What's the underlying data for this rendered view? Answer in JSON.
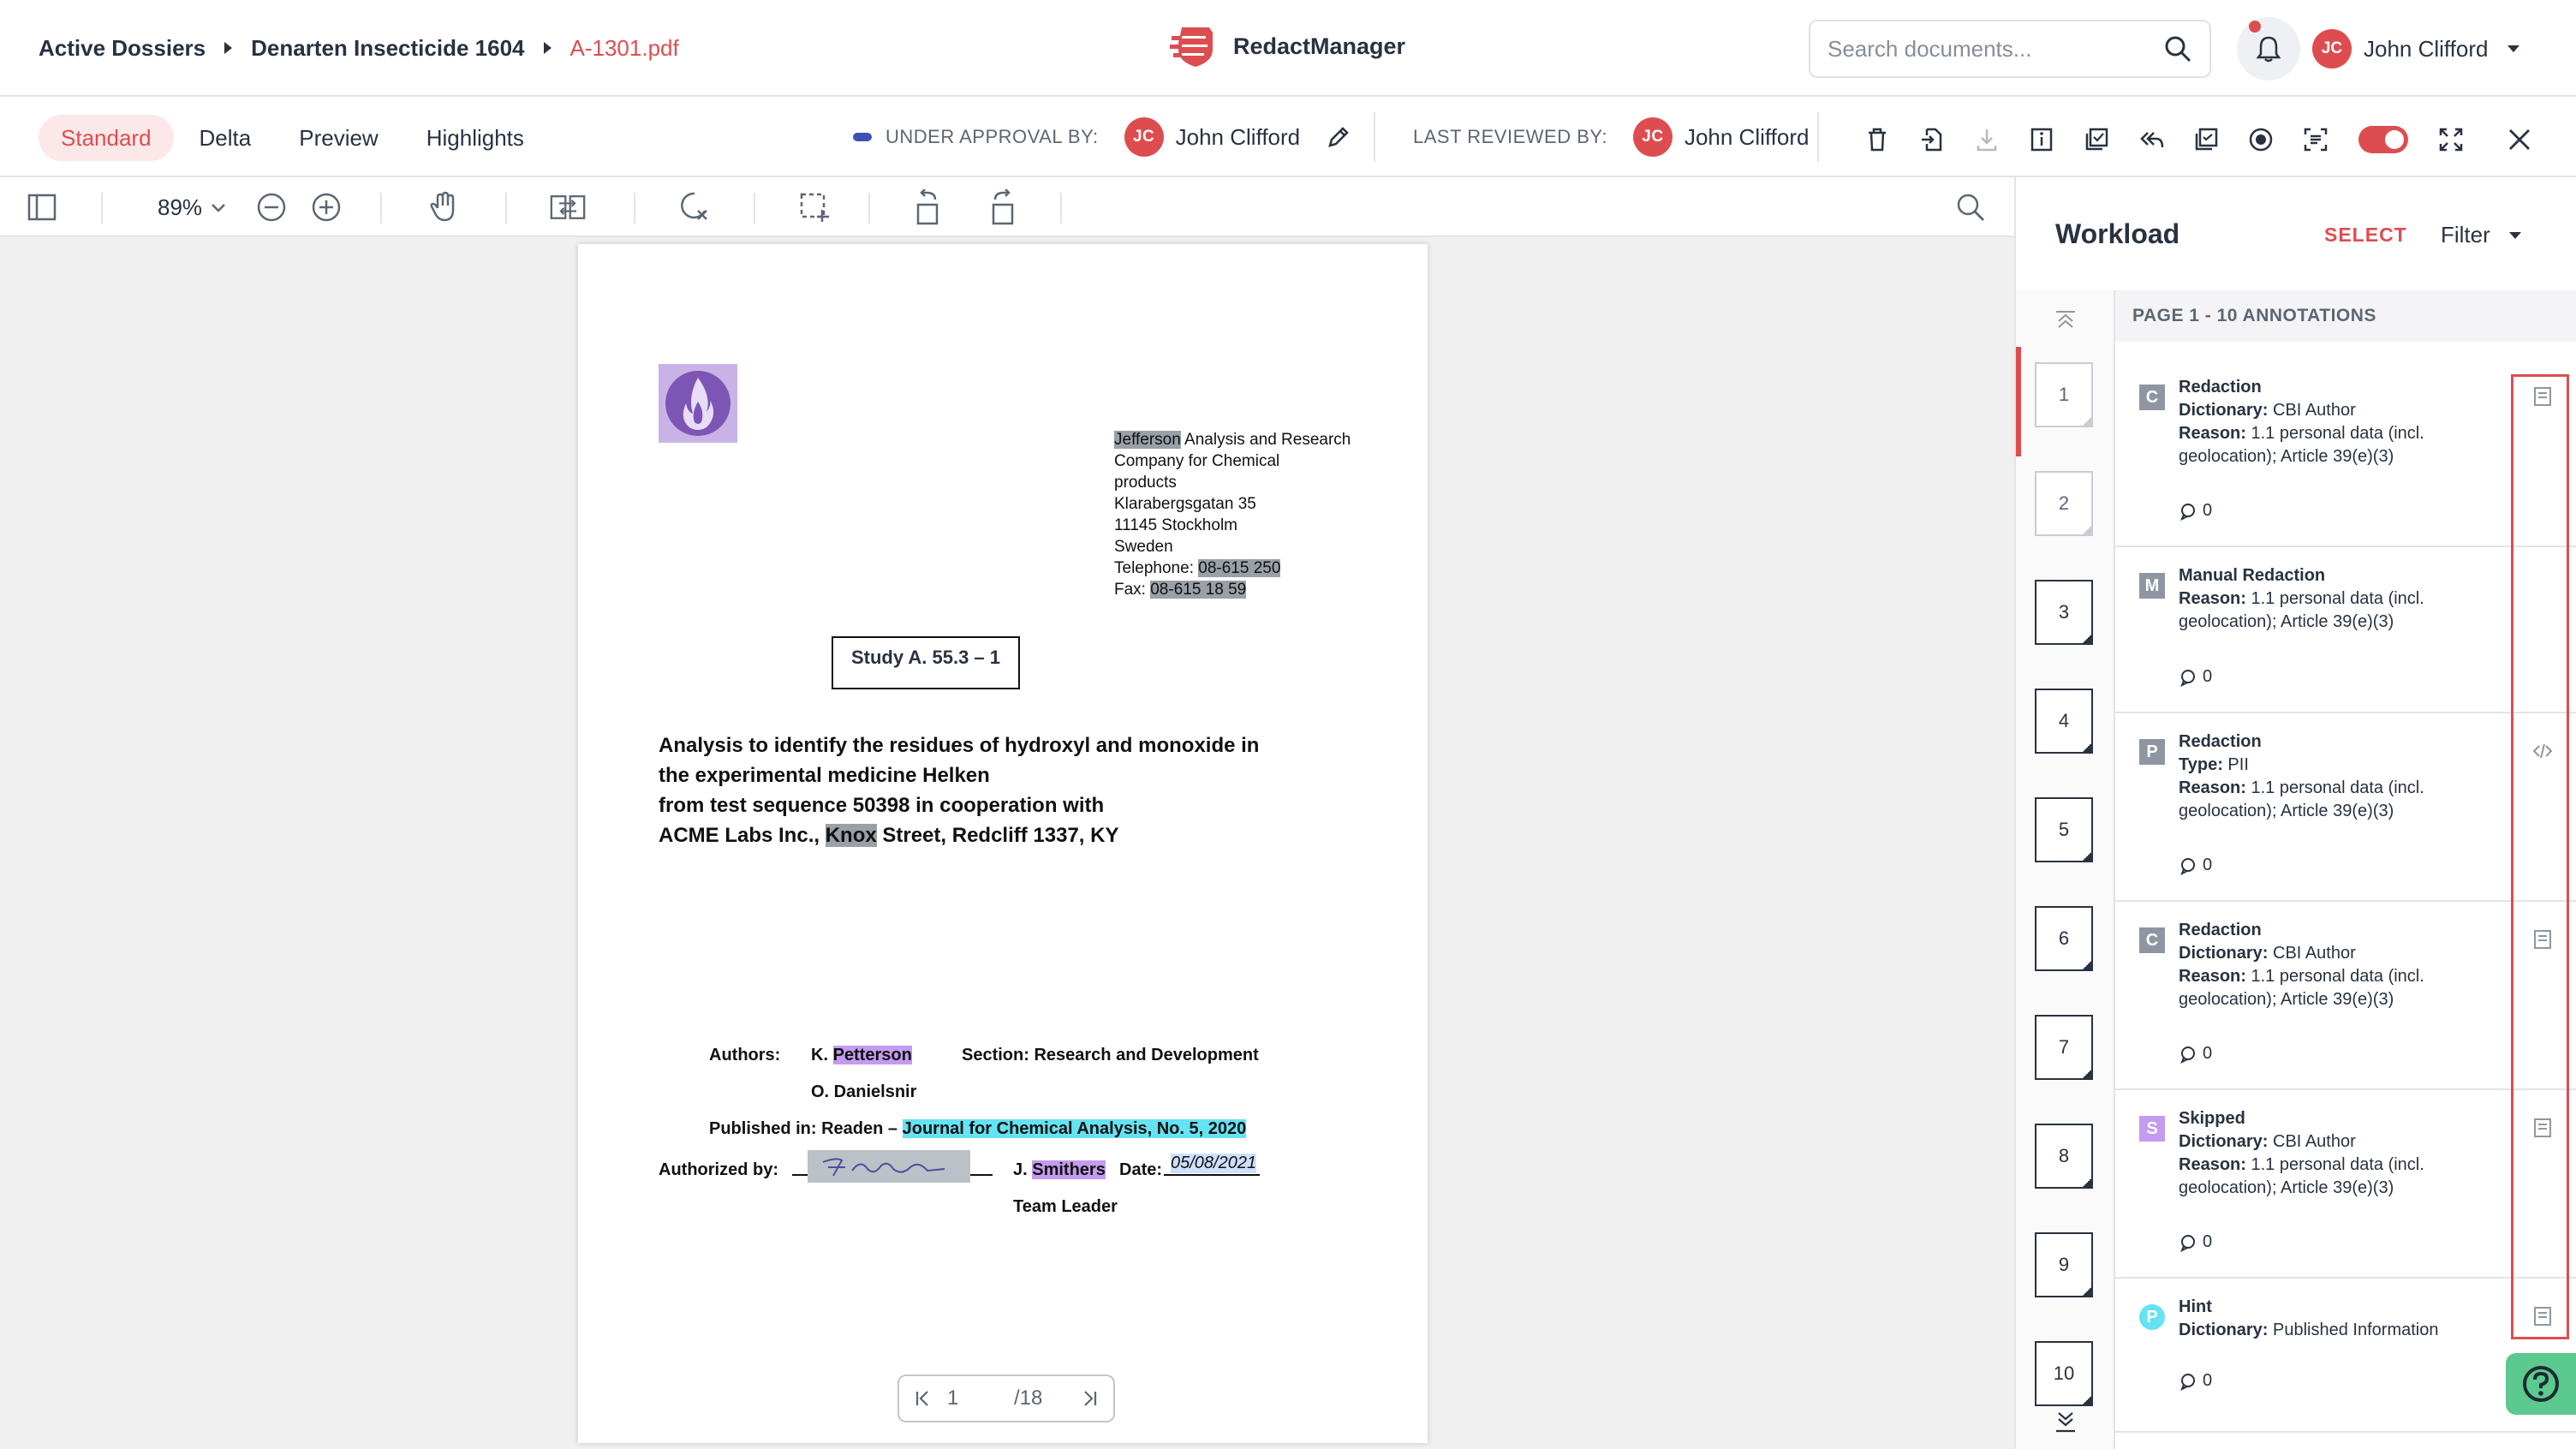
{
  "breadcrumbs": [
    "Active Dossiers",
    "Denarten Insecticide 1604",
    "A-1301.pdf"
  ],
  "brand": {
    "name": "RedactManager",
    "accent": "#dd4d50"
  },
  "search": {
    "placeholder": "Search documents..."
  },
  "user": {
    "initials": "JC",
    "name": "John Clifford"
  },
  "tabs": [
    "Standard",
    "Delta",
    "Preview",
    "Highlights"
  ],
  "status": {
    "approval_label": "UNDER APPROVAL BY:",
    "approval_user": "John Clifford",
    "reviewed_label": "LAST REVIEWED BY:",
    "reviewed_user": "John Clifford"
  },
  "viewer": {
    "zoom": "89",
    "zoom_unit": "%",
    "page": "1",
    "total": "/18"
  },
  "document": {
    "address": {
      "company_redacted": "Jefferson",
      "company_rest": " Analysis and Research",
      "line2": "Company for Chemical",
      "line3": "products",
      "street": "Klarabergsgatan 35",
      "city": "11145 Stockholm",
      "country": "Sweden",
      "tel_label": "Telephone: ",
      "tel": "08-615 250",
      "fax_label": "Fax: ",
      "fax": "08-615 18 59"
    },
    "study": "Study A. 55.3 – 1",
    "title_l1": "Analysis to identify the residues of hydroxyl and monoxide in",
    "title_l2": "the experimental medicine Helken",
    "title_l3": "from test sequence 50398 in cooperation with",
    "title_l4a": "ACME Labs Inc., ",
    "title_l4b": "Knox",
    "title_l4c": " Street, Redcliff 1337, KY",
    "authors_label": "Authors:",
    "author1_init": "K. ",
    "author1_name": "Petterson",
    "section": "Section: Research and Development",
    "author2": "O. Danielsnir",
    "published_label": "Published in: Readen – ",
    "published_journal": "Journal for Chemical Analysis, No. 5, 2020",
    "authorized_label": "Authorized by:",
    "signer_init": "J. ",
    "signer_name": "Smithers",
    "date_label": "Date:",
    "date_value": "05/08/2021",
    "role": "Team Leader"
  },
  "workload": {
    "title": "Workload",
    "select": "SELECT",
    "filter": "Filter",
    "header": "PAGE 1 - 10 ANNOTATIONS",
    "pages": [
      "1",
      "2",
      "3",
      "4",
      "5",
      "6",
      "7",
      "8",
      "9",
      "10"
    ],
    "annotations": [
      {
        "badge": "C",
        "color": "#8f96a1",
        "round": false,
        "type": "Redaction",
        "k1": "Dictionary:",
        "v1": " CBI Author",
        "k2": "Reason:",
        "v2": " 1.1 personal data (incl. geolocation); Article 39(e)(3)",
        "comments": "0"
      },
      {
        "badge": "M",
        "color": "#8f96a1",
        "round": false,
        "type": "Manual Redaction",
        "k1": "Reason:",
        "v1": " 1.1 personal data (incl. geolocation); Article 39(e)(3)",
        "k2": "",
        "v2": "",
        "comments": "0"
      },
      {
        "badge": "P",
        "color": "#8f96a1",
        "round": false,
        "type": "Redaction",
        "k1": "Type:",
        "v1": " PII",
        "k2": "Reason:",
        "v2": " 1.1 personal data (incl. geolocation); Article 39(e)(3)",
        "comments": "0"
      },
      {
        "badge": "C",
        "color": "#8f96a1",
        "round": false,
        "type": "Redaction",
        "k1": "Dictionary:",
        "v1": " CBI Author",
        "k2": "Reason:",
        "v2": " 1.1 personal data (incl. geolocation); Article 39(e)(3)",
        "comments": "0"
      },
      {
        "badge": "S",
        "color": "#c49bf0",
        "round": false,
        "type": "Skipped",
        "k1": "Dictionary:",
        "v1": " CBI Author",
        "k2": "Reason:",
        "v2": " 1.1 personal data (incl. geolocation); Article 39(e)(3)",
        "comments": "0"
      },
      {
        "badge": "P",
        "color": "#64e3f2",
        "round": true,
        "type": "Hint",
        "k1": "Dictionary:",
        "v1": " Published Information",
        "k2": "",
        "v2": "",
        "comments": "0"
      }
    ]
  }
}
